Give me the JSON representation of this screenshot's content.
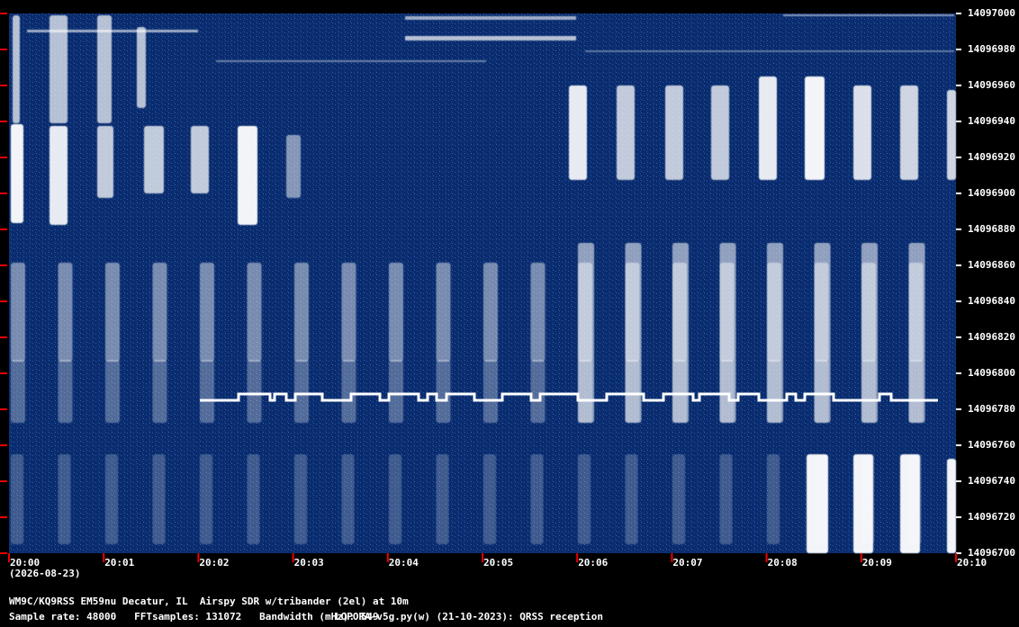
{
  "colors": {
    "background": "#001a55",
    "signal": "#ffffff",
    "tick": "#ee0000",
    "text": "#ffffff"
  },
  "y_axis": {
    "labels": [
      "14097000",
      "14096980",
      "14096960",
      "14096940",
      "14096920",
      "14096900",
      "14096880",
      "14096860",
      "14096840",
      "14096820",
      "14096800",
      "14096780",
      "14096760",
      "14096740",
      "14096720",
      "14096700"
    ]
  },
  "x_axis": {
    "labels": [
      "20:00",
      "20:01",
      "20:02",
      "20:03",
      "20:04",
      "20:05",
      "20:06",
      "20:07",
      "20:08",
      "20:09",
      "20:10"
    ],
    "date": "(2026-08-23)"
  },
  "footer": {
    "station": "WM9C/KQ9RSS EM59nu Decatur, IL  Airspy SDR w/tribander (2el) at 10m",
    "params": "Sample rate: 48000   FFTsamples: 131072   Bandwidth (mHz): 549",
    "software": "LOPORA-v5g.py(w) (21-10-2023): QRSS reception"
  }
}
